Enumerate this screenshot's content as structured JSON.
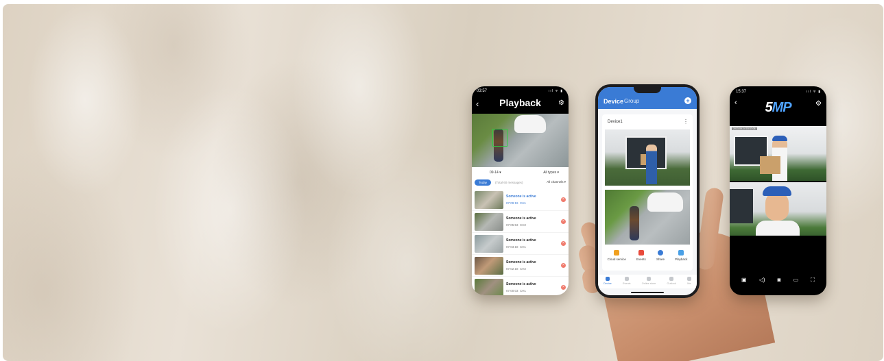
{
  "playback_phone": {
    "status_time": "03:57",
    "status_icons": "ııl ᯤ ▮",
    "title": "Playback",
    "filter_date": "09-14 ▾",
    "filter_types": "All types ▾",
    "tab_today": "Today",
    "tab_total": "(Total 60 messages)",
    "tab_channels": "All channels ▾",
    "events": [
      {
        "label": "Someone is active",
        "time": "07:09:19",
        "channel": "CH1"
      },
      {
        "label": "Someone is active",
        "time": "07:05:53",
        "channel": "CH2"
      },
      {
        "label": "Someone is active",
        "time": "07:03:18",
        "channel": "CH1"
      },
      {
        "label": "Someone is active",
        "time": "07:02:18",
        "channel": "CH2"
      },
      {
        "label": "Someone is active",
        "time": "07:00:03",
        "channel": "CH1"
      }
    ]
  },
  "device_phone": {
    "header_tab_device": "Device",
    "header_tab_group": "Group",
    "device_name": "Device1",
    "actions": [
      {
        "label": "Cloud service",
        "color": "#f0a020"
      },
      {
        "label": "Events",
        "color": "#e84a3c"
      },
      {
        "label": "Share",
        "color": "#3a7bd5"
      },
      {
        "label": "Playback",
        "color": "#4aa0e6"
      }
    ],
    "nav": [
      {
        "label": "Device"
      },
      {
        "label": "Events"
      },
      {
        "label": "Online store"
      },
      {
        "label": "Outlook"
      },
      {
        "label": "Me"
      }
    ]
  },
  "live_phone": {
    "status_time": "15:37",
    "status_icons": "ııl ᯤ ▮",
    "logo_number": "5",
    "logo_suffix": "MP",
    "camera_stamp": "2023-09-14 15:37:08"
  },
  "colors": {
    "accent": "#3a7bd5",
    "delete": "#f07b6d"
  }
}
